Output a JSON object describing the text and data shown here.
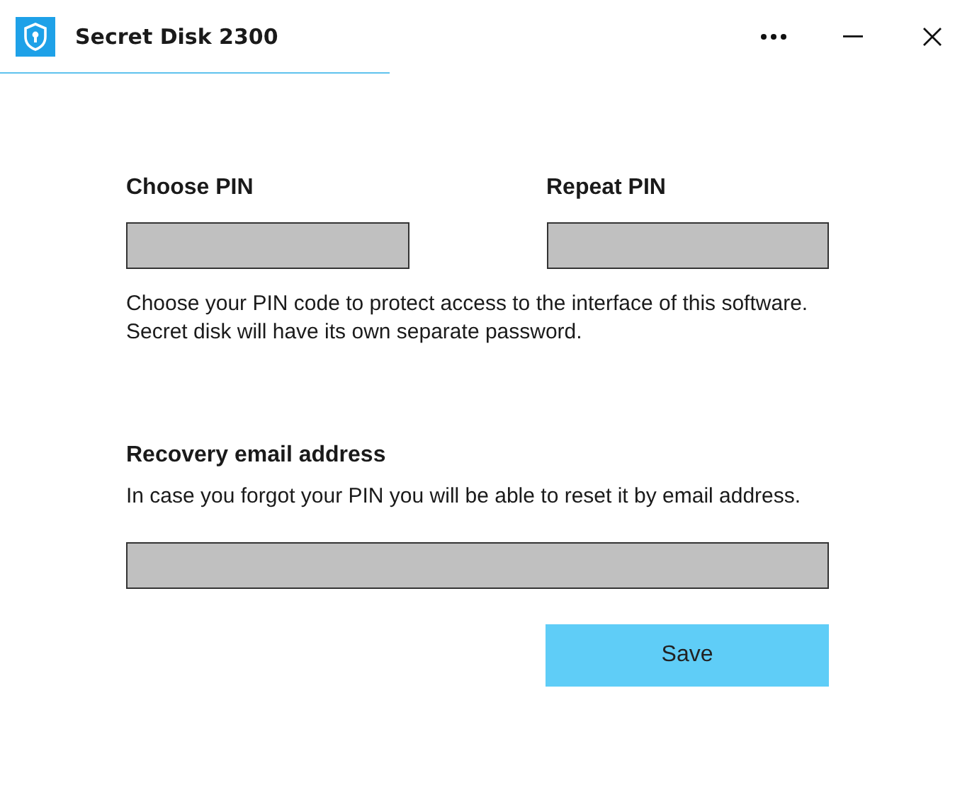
{
  "window": {
    "title": "Secret Disk 2300"
  },
  "pin": {
    "choose_label": "Choose PIN",
    "repeat_label": "Repeat PIN",
    "help": "Choose your PIN code to protect access to the interface of this software. Secret disk will have its own separate password."
  },
  "recovery": {
    "label": "Recovery email address",
    "help": "In case you forgot your PIN you will be able to reset it by email address."
  },
  "buttons": [
    "Save"
  ]
}
